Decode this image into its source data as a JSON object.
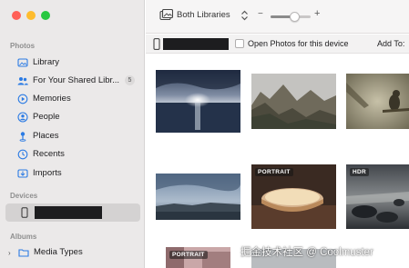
{
  "window": {
    "traffic_lights": {
      "close": "#ff5f57",
      "minimize": "#febc2e",
      "zoom": "#28c840"
    }
  },
  "sidebar": {
    "photos_section": "Photos",
    "items": [
      {
        "label": "Library",
        "icon": "library-icon"
      },
      {
        "label": "For Your Shared Libr...",
        "icon": "shared-people-icon",
        "badge": "5"
      },
      {
        "label": "Memories",
        "icon": "memories-icon"
      },
      {
        "label": "People",
        "icon": "people-icon"
      },
      {
        "label": "Places",
        "icon": "places-pin-icon"
      },
      {
        "label": "Recents",
        "icon": "clock-icon"
      },
      {
        "label": "Imports",
        "icon": "imports-icon"
      }
    ],
    "devices_section": "Devices",
    "device_label": "",
    "albums_section": "Albums",
    "albums_items": [
      {
        "label": "Media Types",
        "icon": "folder-icon"
      }
    ]
  },
  "toolbar": {
    "library_select": "Both Libraries",
    "zoom_minus": "−",
    "zoom_plus": "+",
    "zoom_level": 0.6
  },
  "import_bar": {
    "device_name": "",
    "open_photos_label": "Open Photos for this device",
    "open_photos_checked": false,
    "add_to_label": "Add To:"
  },
  "photos": [
    {
      "name": "photo-sea-sunset",
      "label": ""
    },
    {
      "name": "photo-mountains",
      "label": ""
    },
    {
      "name": "photo-bird",
      "label": ""
    },
    {
      "name": "photo-coast-city",
      "label": ""
    },
    {
      "name": "photo-pie",
      "label": "PORTRAIT"
    },
    {
      "name": "photo-rocks-hdr",
      "label": "HDR"
    },
    {
      "name": "photo-portrait-row3",
      "label": "PORTRAIT"
    }
  ],
  "watermark": "掘金技术社区 @ Coolmuster",
  "colors": {
    "sidebar_bg": "#ebe9e9",
    "accent_blue": "#2b7be4"
  }
}
